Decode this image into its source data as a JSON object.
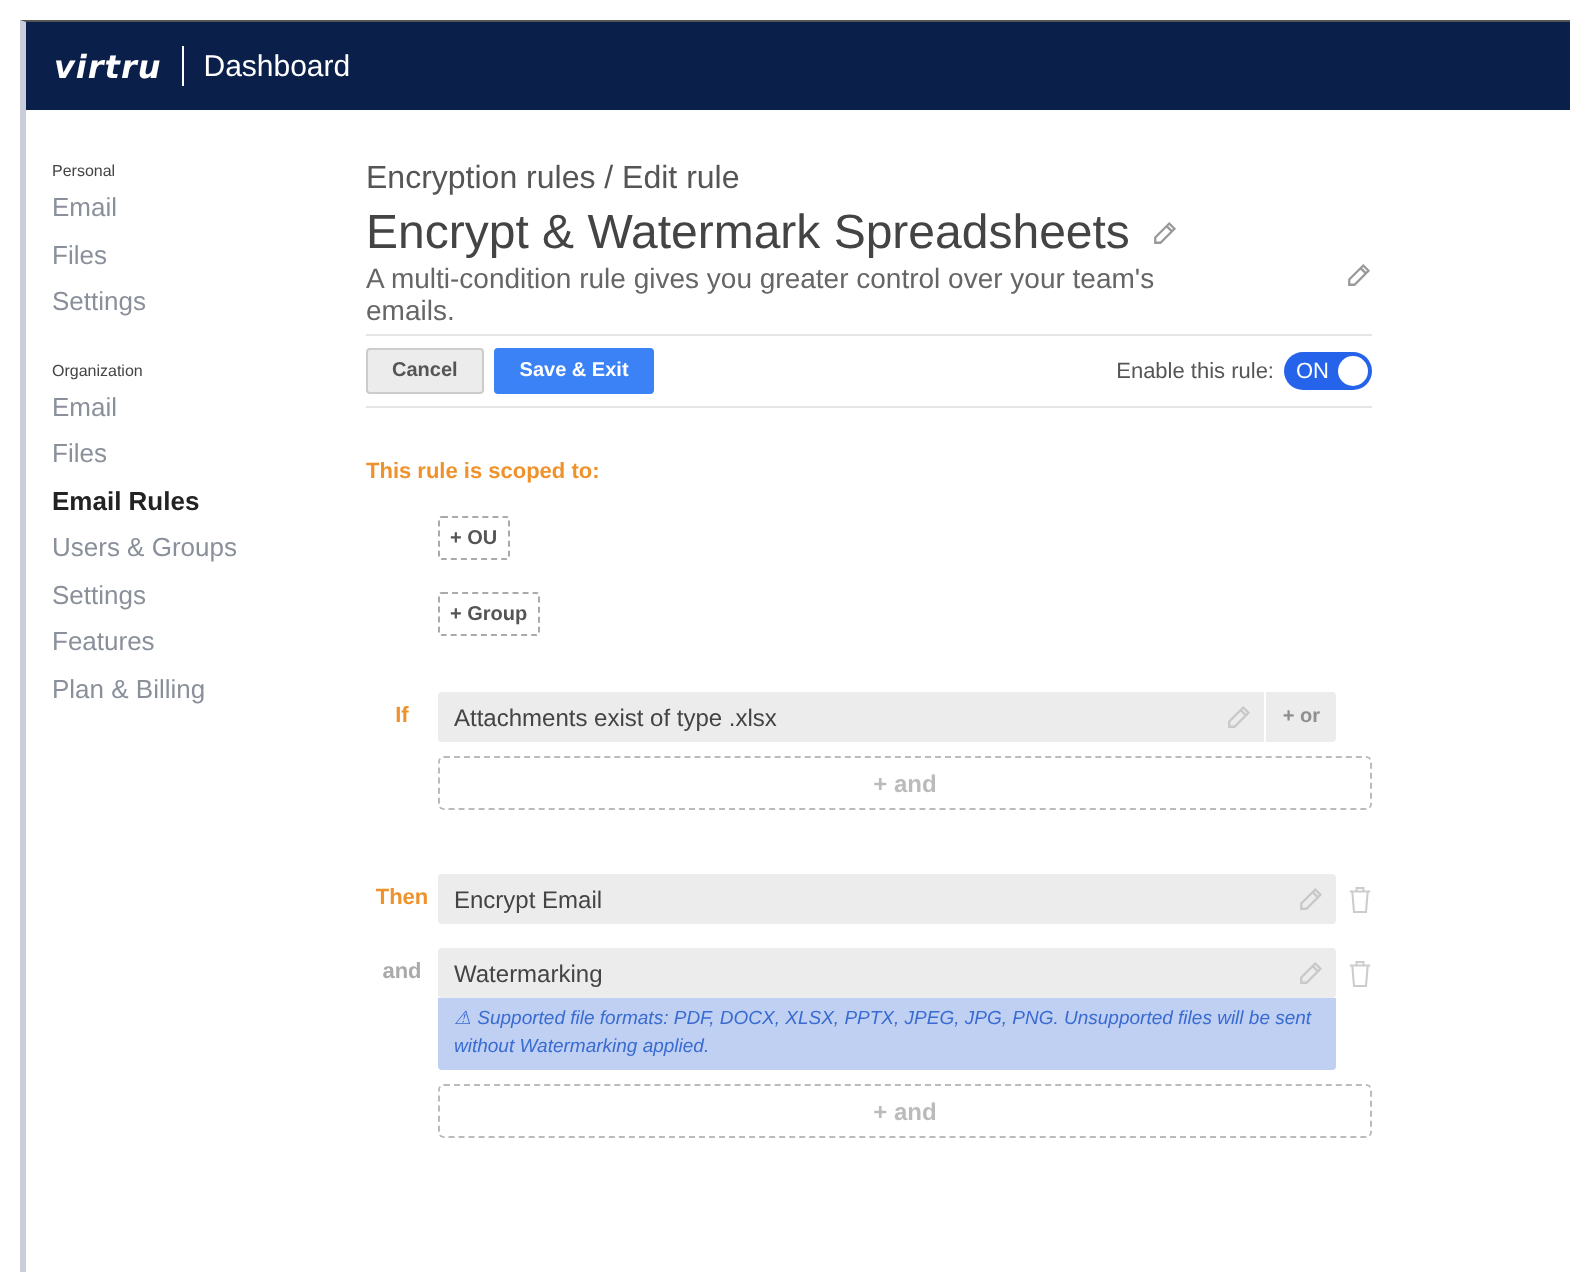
{
  "header": {
    "logo": "virtru",
    "title": "Dashboard"
  },
  "sidebar": {
    "sections": [
      {
        "heading": "Personal",
        "items": [
          {
            "label": "Email",
            "selected": false
          },
          {
            "label": "Files",
            "selected": false
          },
          {
            "label": "Settings",
            "selected": false
          }
        ]
      },
      {
        "heading": "Organization",
        "items": [
          {
            "label": "Email",
            "selected": false
          },
          {
            "label": "Files",
            "selected": false
          },
          {
            "label": "Email Rules",
            "selected": true
          },
          {
            "label": "Users & Groups",
            "selected": false
          },
          {
            "label": "Settings",
            "selected": false
          },
          {
            "label": "Features",
            "selected": false
          },
          {
            "label": "Plan & Billing",
            "selected": false
          }
        ]
      }
    ]
  },
  "breadcrumb": "Encryption rules / Edit rule",
  "title": "Encrypt & Watermark Spreadsheets",
  "description": "A multi-condition rule gives you greater control over your team's emails.",
  "buttons": {
    "cancel": "Cancel",
    "save": "Save & Exit"
  },
  "enable": {
    "label": "Enable this rule:",
    "on": true,
    "on_text": "ON"
  },
  "scope": {
    "heading": "This rule is scoped to:",
    "buttons": [
      "+ OU",
      "+ Group"
    ]
  },
  "conditions": [
    {
      "label": "If",
      "text": "Attachments exist of type .xlsx",
      "or": "+ or"
    }
  ],
  "conditions_add": "+ and",
  "actions": [
    {
      "label": "Then",
      "text": "Encrypt Email"
    },
    {
      "label": "and",
      "text": "Watermarking",
      "note": "⚠ Supported file formats: PDF, DOCX, XLSX, PPTX, JPEG, JPG, PNG. Unsupported files will be sent without Watermarking applied."
    }
  ],
  "actions_add": "+ and"
}
